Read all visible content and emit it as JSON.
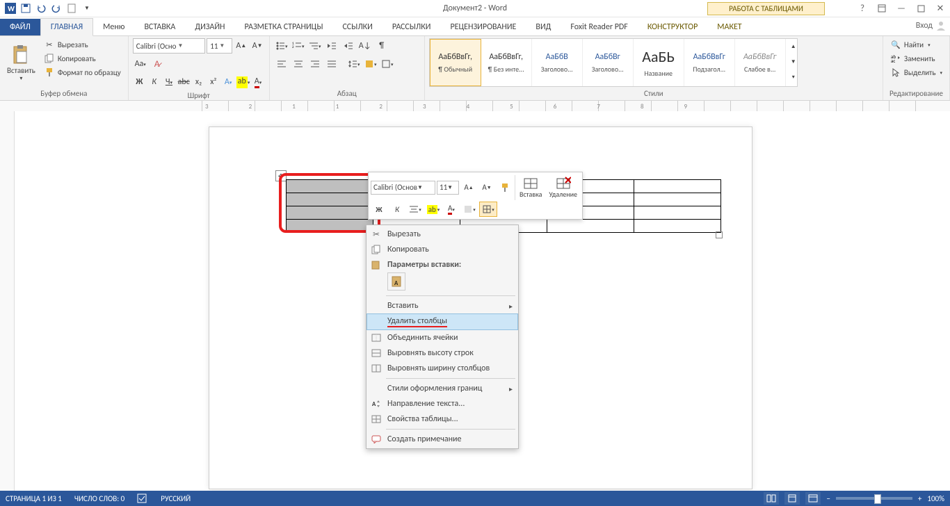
{
  "title": "Документ2 - Word",
  "tableToolsLabel": "РАБОТА С ТАБЛИЦАМИ",
  "signin": "Вход",
  "tabs": {
    "file": "ФАЙЛ",
    "home": "ГЛАВНАЯ",
    "menu": "Меню",
    "insert": "ВСТАВКА",
    "design": "ДИЗАЙН",
    "layout": "РАЗМЕТКА СТРАНИЦЫ",
    "references": "ССЫЛКИ",
    "mailings": "РАССЫЛКИ",
    "review": "РЕЦЕНЗИРОВАНИЕ",
    "view": "ВИД",
    "foxit": "Foxit Reader PDF",
    "tdesign": "КОНСТРУКТОР",
    "tlayout": "МАКЕТ"
  },
  "clipboard": {
    "paste": "Вставить",
    "cut": "Вырезать",
    "copy": "Копировать",
    "formatPainter": "Формат по образцу",
    "group": "Буфер обмена"
  },
  "font": {
    "family": "Calibri (Осно",
    "size": "11",
    "group": "Шрифт",
    "bold": "Ж",
    "italic": "К",
    "underline": "Ч",
    "strike": "abc",
    "sub": "x₂",
    "sup": "x²"
  },
  "para": {
    "group": "Абзац"
  },
  "styles": {
    "group": "Стили",
    "items": [
      {
        "preview": "АаБбВвГг,",
        "name": "¶ Обычный"
      },
      {
        "preview": "АаБбВвГг,",
        "name": "¶ Без инте..."
      },
      {
        "preview": "АаБбВ",
        "name": "Заголово...",
        "blue": true
      },
      {
        "preview": "АаБбВг",
        "name": "Заголово...",
        "blue": true
      },
      {
        "preview": "АаБЬ",
        "name": "Название",
        "big": true
      },
      {
        "preview": "АаБбВвГг",
        "name": "Подзагол...",
        "blue": true
      },
      {
        "preview": "АаБбВвГг",
        "name": "Слабое в...",
        "italic": true
      }
    ]
  },
  "editing": {
    "find": "Найти",
    "replace": "Заменить",
    "select": "Выделить",
    "group": "Редактирование"
  },
  "miniToolbar": {
    "font": "Calibri (Основ",
    "size": "11",
    "insertBtn": "Вставка",
    "deleteBtn": "Удаление",
    "bold": "Ж",
    "italic": "К"
  },
  "contextMenu": {
    "cut": "Вырезать",
    "copy": "Копировать",
    "pasteLabel": "Параметры вставки:",
    "insert": "Вставить",
    "deleteCols": "Удалить столбцы",
    "merge": "Объединить ячейки",
    "distRows": "Выровнять высоту строк",
    "distCols": "Выровнять ширину столбцов",
    "borderStyles": "Стили оформления границ",
    "textDir": "Направление текста...",
    "tableProps": "Свойства таблицы...",
    "comment": "Создать примечание"
  },
  "status": {
    "page": "СТРАНИЦА 1 ИЗ 1",
    "words": "ЧИСЛО СЛОВ: 0",
    "lang": "РУССКИЙ",
    "zoom": "100%"
  }
}
